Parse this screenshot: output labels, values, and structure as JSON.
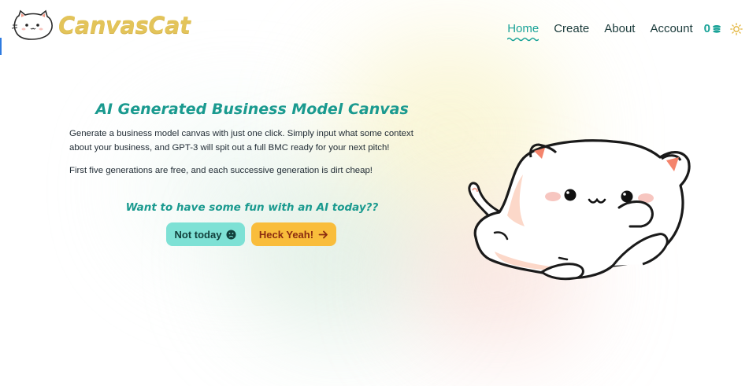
{
  "brand": {
    "name": "CanvasCat",
    "logo_icon": "cat-face-icon"
  },
  "nav": {
    "items": [
      {
        "label": "Home",
        "active": true
      },
      {
        "label": "Create",
        "active": false
      },
      {
        "label": "About",
        "active": false
      },
      {
        "label": "Account",
        "active": false
      }
    ],
    "coins": "0",
    "coins_icon": "coin-stack-icon",
    "theme_icon": "sun-icon"
  },
  "hero": {
    "title": "AI Generated Business Model Canvas",
    "description": "Generate a business model canvas with just one click. Simply input what some context about your business, and GPT-3 will spit out a full BMC ready for your next pitch!",
    "note": "First five generations are free, and each successive generation is dirt cheap!",
    "question": "Want to have some fun with an AI today??",
    "buttons": {
      "no": {
        "label": "Not today",
        "icon": "sad-face-icon"
      },
      "yes": {
        "label": "Heck Yeah!",
        "icon": "arrow-right-icon"
      }
    }
  },
  "colors": {
    "accent": "#1aa398",
    "brand_yellow": "#e3c45a",
    "button_no": "#7ee1d5",
    "button_yes": "#f9bd3b"
  }
}
